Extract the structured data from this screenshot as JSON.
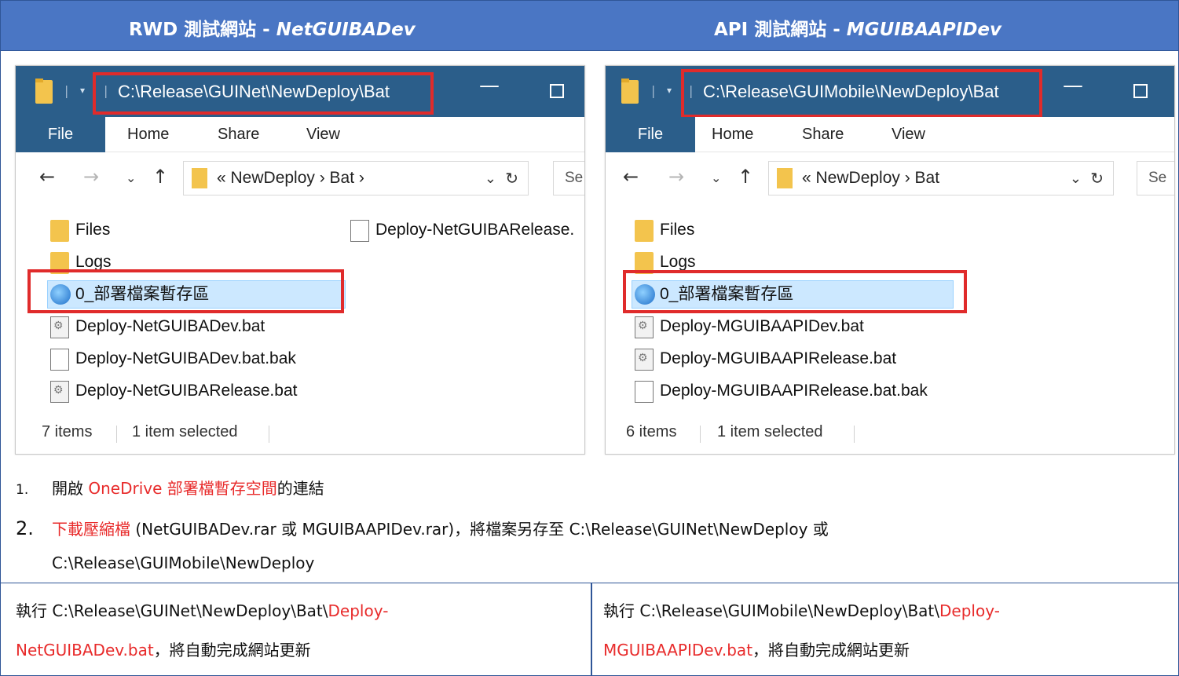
{
  "header": {
    "left_title": "RWD  測試網站 - ",
    "left_sub": "NetGUIBADev",
    "right_title": "API  測試網站 - ",
    "right_sub": "MGUIBAAPIDev"
  },
  "left_explorer": {
    "path": "C:\\Release\\GUINet\\NewDeploy\\Bat",
    "ribbon": [
      "File",
      "Home",
      "Share",
      "View"
    ],
    "address": "« NewDeploy  ›  Bat  ›",
    "search_placeholder": "Se",
    "files": [
      {
        "name": "Files",
        "icon": "folder-icon"
      },
      {
        "name": "Logs",
        "icon": "folder-icon"
      },
      {
        "name": "0_部署檔案暫存區",
        "icon": "onedrive-shortcut-icon"
      },
      {
        "name": "Deploy-NetGUIBADev.bat",
        "icon": "bat-file-icon"
      },
      {
        "name": "Deploy-NetGUIBADev.bat.bak",
        "icon": "document-icon"
      },
      {
        "name": "Deploy-NetGUIBARelease.bat",
        "icon": "bat-file-icon"
      },
      {
        "name": "Deploy-NetGUIBARelease.",
        "icon": "document-icon"
      }
    ],
    "status_count": "7 items",
    "status_selected": "1 item selected"
  },
  "right_explorer": {
    "path": "C:\\Release\\GUIMobile\\NewDeploy\\Bat",
    "ribbon": [
      "File",
      "Home",
      "Share",
      "View"
    ],
    "address": "« NewDeploy  ›  Bat",
    "search_placeholder": "Se",
    "files": [
      {
        "name": "Files",
        "icon": "folder-icon"
      },
      {
        "name": "Logs",
        "icon": "folder-icon"
      },
      {
        "name": "0_部署檔案暫存區",
        "icon": "onedrive-shortcut-icon"
      },
      {
        "name": "Deploy-MGUIBAAPIDev.bat",
        "icon": "bat-file-icon"
      },
      {
        "name": "Deploy-MGUIBAAPIRelease.bat",
        "icon": "bat-file-icon"
      },
      {
        "name": "Deploy-MGUIBAAPIRelease.bat.bak",
        "icon": "document-icon"
      }
    ],
    "status_count": "6 items",
    "status_selected": "1 item selected"
  },
  "steps": {
    "s1_num": "1.",
    "s1_pre": "開啟 ",
    "s1_link": "OneDrive 部署檔暫存空間",
    "s1_post": "的連結",
    "s2_num": "2.",
    "s2_link": "下載壓縮檔",
    "s2_text": " (NetGUIBADev.rar 或 MGUIBAAPIDev.rar)，將檔案另存至 C:\\Release\\GUINet\\NewDeploy  或",
    "s2_line2": "C:\\Release\\GUIMobile\\NewDeploy"
  },
  "bottom": {
    "left_pre": "執行 C:\\Release\\GUINet\\NewDeploy\\Bat\\",
    "left_link1": "Deploy-",
    "left_link2": "NetGUIBADev.bat",
    "left_post": "，將自動完成網站更新",
    "right_pre": "執行 C:\\Release\\GUIMobile\\NewDeploy\\Bat\\",
    "right_link1": "Deploy-",
    "right_link2": "MGUIBAAPIDev.bat",
    "right_post": "，將自動完成網站更新"
  },
  "colors": {
    "header": "#4a76c4",
    "highlight_red": "#e02b2b",
    "titlebar": "#2b5e8a",
    "link_red": "#e82b2b"
  }
}
